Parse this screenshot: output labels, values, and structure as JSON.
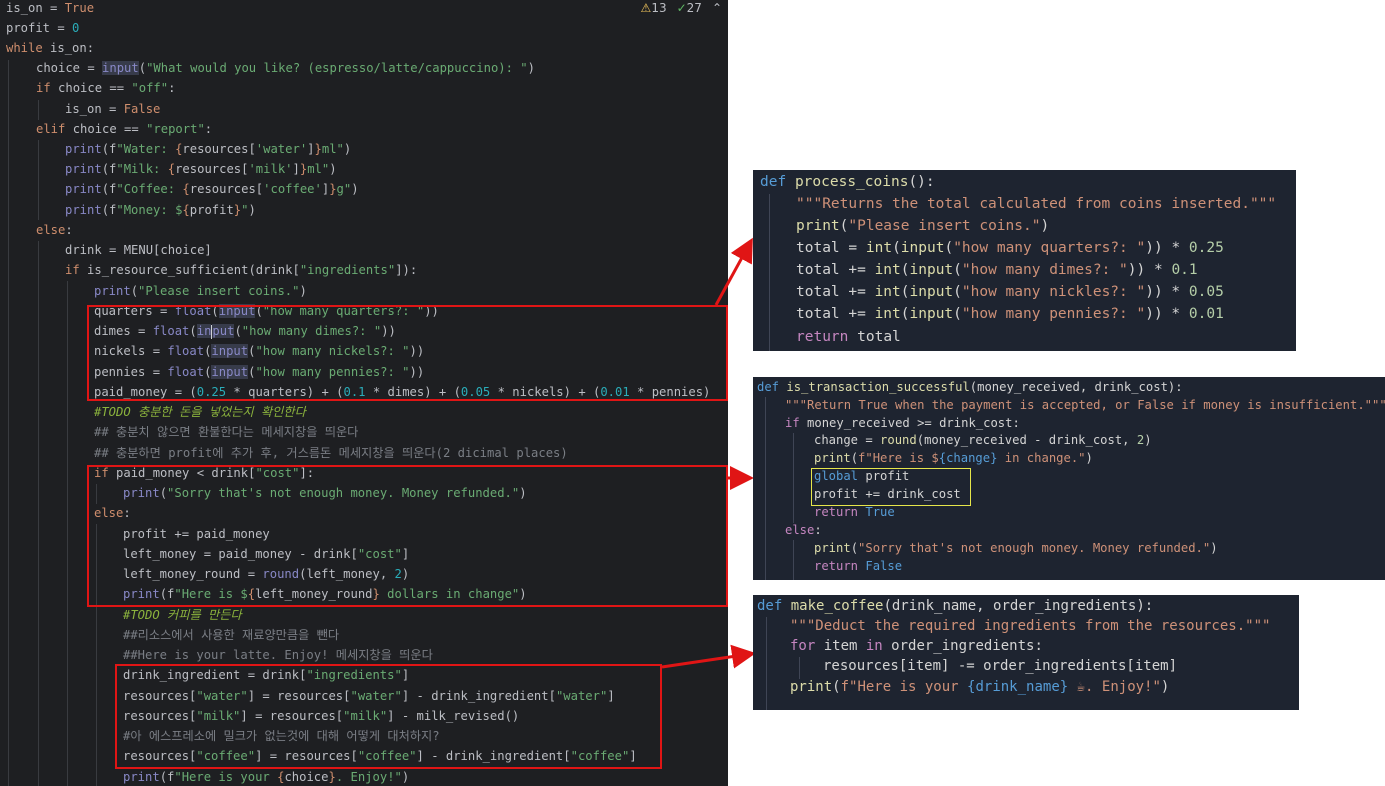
{
  "editor": {
    "indicators": {
      "warnings": "13",
      "checks": "27",
      "collapse": "⌃"
    },
    "lines": [
      [
        "is_on = ",
        "True"
      ],
      [
        "profit = ",
        "0"
      ],
      [
        "while",
        " is_on:"
      ],
      [
        "choice = ",
        "input",
        "(",
        "\"What would you like? (espresso/latte/cappuccino): \"",
        ")"
      ],
      [
        "if",
        " choice == ",
        "\"off\"",
        ":"
      ],
      [
        "is_on = ",
        "False"
      ],
      [
        "elif",
        " choice == ",
        "\"report\"",
        ":"
      ],
      [
        "print",
        "(f",
        "\"Water: ",
        "{",
        "resources[",
        "'water'",
        "]",
        "}",
        "ml\"",
        ")"
      ],
      [
        "print",
        "(f",
        "\"Milk: ",
        "{",
        "resources[",
        "'milk'",
        "]",
        "}",
        "ml\"",
        ")"
      ],
      [
        "print",
        "(f",
        "\"Coffee: ",
        "{",
        "resources[",
        "'coffee'",
        "]",
        "}",
        "g\"",
        ")"
      ],
      [
        "print",
        "(f",
        "\"Money: $",
        "{",
        "profit",
        "}",
        "\"",
        ")"
      ],
      [
        "else",
        ":"
      ],
      [
        "drink = MENU[choice]"
      ],
      [
        "if",
        " is_resource_sufficient(drink[",
        "\"ingredients\"",
        "]):"
      ],
      [
        "print",
        "(",
        "\"Please insert coins.\"",
        ")"
      ],
      [
        "quarters = ",
        "float",
        "(",
        "input",
        "(",
        "\"how many quarters?: \"",
        "))"
      ],
      [
        "dimes = ",
        "float",
        "(",
        "in",
        "put",
        "(",
        "\"how many dimes?: \"",
        "))"
      ],
      [
        "nickels = ",
        "float",
        "(",
        "input",
        "(",
        "\"how many nickels?: \"",
        "))"
      ],
      [
        "pennies = ",
        "float",
        "(",
        "input",
        "(",
        "\"how many pennies?: \"",
        "))"
      ],
      [
        "paid_money = (",
        "0.25",
        " * quarters) + (",
        "0.1",
        " * dimes) + (",
        "0.05",
        " * nickels) + (",
        "0.01",
        " * pennies)"
      ],
      [
        "#TODO 충분한 돈을 넣었는지 확인한다"
      ],
      [
        "## 충분치 않으면 환불한다는 메세지창을 띄운다"
      ],
      [
        "## 충분하면 profit에 추가 후, 거스름돈 메세지창을 띄운다(2 dicimal places)"
      ],
      [
        "if",
        " paid_money < drink[",
        "\"cost\"",
        "]:"
      ],
      [
        "print",
        "(",
        "\"Sorry that's not enough money. Money refunded.\"",
        ")"
      ],
      [
        "else",
        ":"
      ],
      [
        "profit += paid_money"
      ],
      [
        "left_money = paid_money - drink[",
        "\"cost\"",
        "]"
      ],
      [
        "left_money_round = ",
        "round",
        "(left_money, ",
        "2",
        ")"
      ],
      [
        "print",
        "(f",
        "\"Here is $",
        "{",
        "left_money_round",
        "}",
        " dollars in change\"",
        ")"
      ],
      [
        "#TODO 커피를 만든다"
      ],
      [
        "##리소스에서 사용한 재료양만큼을 뺀다"
      ],
      [
        "##Here is your latte. Enjoy! 메세지창을 띄운다"
      ],
      [
        "drink_ingredient = drink[",
        "\"ingredients\"",
        "]"
      ],
      [
        "resources[",
        "\"water\"",
        "] = resources[",
        "\"water\"",
        "] - drink_ingredient[",
        "\"water\"",
        "]"
      ],
      [
        "resources[",
        "\"milk\"",
        "] = resources[",
        "\"milk\"",
        "] - milk_revised()"
      ],
      [
        "#아 에스프레소에 밀크가 없는것에 대해 어떻게 대처하지?"
      ],
      [
        "resources[",
        "\"coffee\"",
        "] = resources[",
        "\"coffee\"",
        "] - drink_ingredient[",
        "\"coffee\"",
        "]"
      ],
      [
        "print",
        "(f",
        "\"Here is your ",
        "{",
        "choice",
        "}",
        ". Enjoy!\"",
        ")"
      ]
    ]
  },
  "panel1": {
    "lines": [
      [
        "def",
        " ",
        "process_coins",
        "():"
      ],
      [
        "\"\"\"Returns the total calculated from coins inserted.\"\"\""
      ],
      [
        "print",
        "(",
        "\"Please insert coins.\"",
        ")"
      ],
      [
        "total",
        " = ",
        "int",
        "(",
        "input",
        "(",
        "\"how many quarters?: \"",
        ")) * ",
        "0.25"
      ],
      [
        "total",
        " += ",
        "int",
        "(",
        "input",
        "(",
        "\"how many dimes?: \"",
        ")) * ",
        "0.1"
      ],
      [
        "total",
        " += ",
        "int",
        "(",
        "input",
        "(",
        "\"how many nickles?: \"",
        ")) * ",
        "0.05"
      ],
      [
        "total",
        " += ",
        "int",
        "(",
        "input",
        "(",
        "\"how many pennies?: \"",
        ")) * ",
        "0.01"
      ],
      [
        "return",
        " ",
        "total"
      ]
    ]
  },
  "panel2": {
    "lines": [
      [
        "def",
        " ",
        "is_transaction_successful",
        "(money_received, drink_cost):"
      ],
      [
        "\"\"\"Return True when the payment is accepted, or False if money is insufficient.\"\"\""
      ],
      [
        "if",
        " money_received >= drink_cost:"
      ],
      [
        "change = ",
        "round",
        "(money_received - drink_cost, ",
        "2",
        ")"
      ],
      [
        "print",
        "(",
        "f\"Here is $",
        "{change}",
        " in change.\"",
        ")"
      ],
      [
        "global",
        " profit"
      ],
      [
        "profit += drink_cost"
      ],
      [
        "return",
        " ",
        "True"
      ],
      [
        "else",
        ":"
      ],
      [
        "print",
        "(",
        "\"Sorry that's not enough money. Money refunded.\"",
        ")"
      ],
      [
        "return",
        " ",
        "False"
      ]
    ]
  },
  "panel3": {
    "lines": [
      [
        "def",
        " ",
        "make_coffee",
        "(drink_name, order_ingredients):"
      ],
      [
        "\"\"\"Deduct the required ingredients from the resources.\"\"\""
      ],
      [
        "for",
        " item ",
        "in",
        " order_ingredients:"
      ],
      [
        "resources[item] -= order_ingredients[item]"
      ],
      [
        "print",
        "(",
        "f\"Here is your ",
        "{drink_name}",
        " ☕. Enjoy!\"",
        ")"
      ]
    ]
  },
  "colors": {
    "annotation_red": "#e01515",
    "highlight_yellow": "#e6e64a"
  }
}
